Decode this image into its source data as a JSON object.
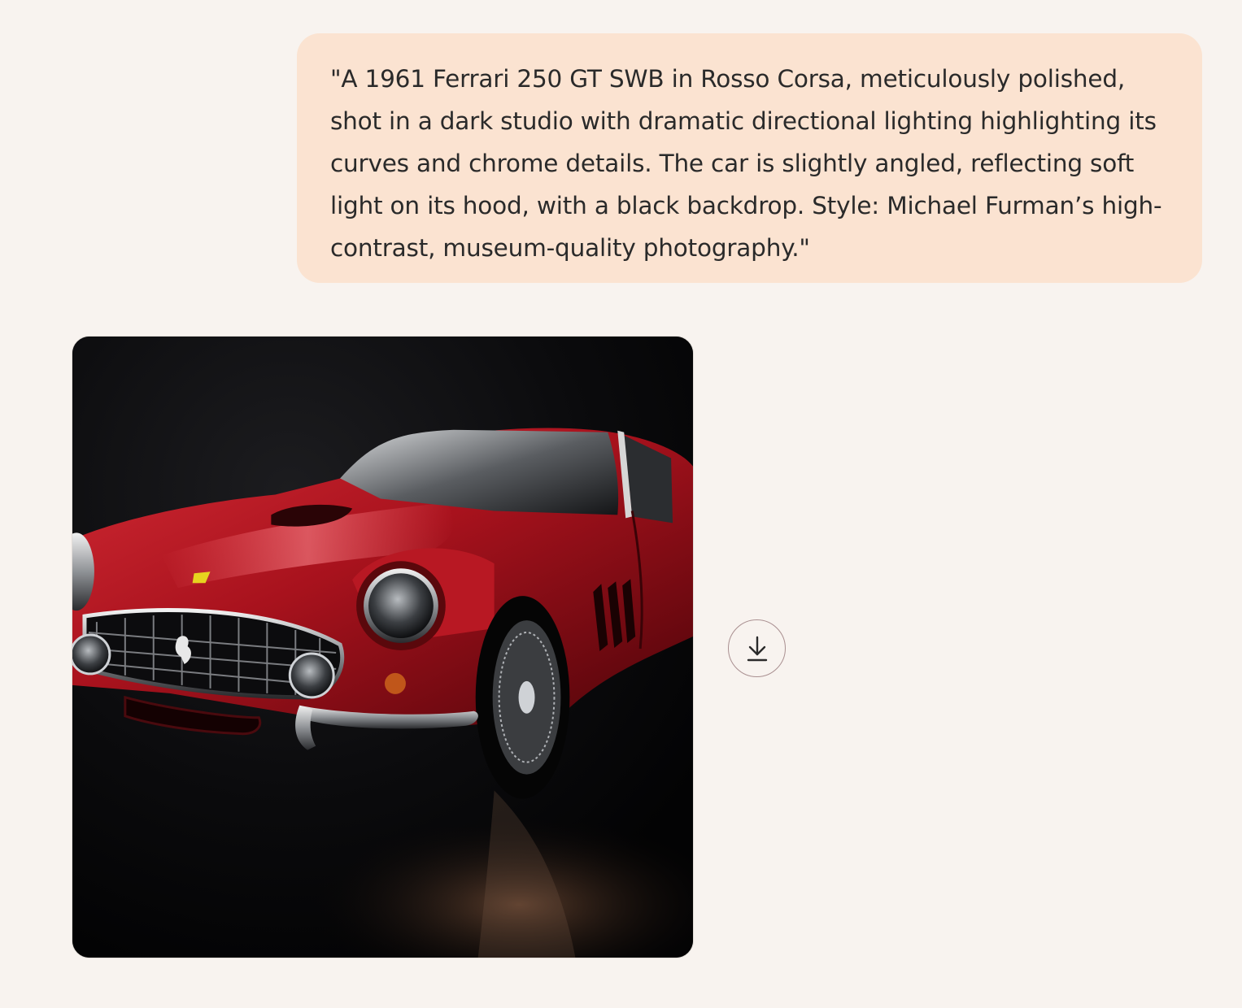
{
  "conversation": {
    "user_message": {
      "text": "\"A 1961 Ferrari 250 GT SWB in Rosso Corsa, meticulously polished, shot in a dark studio with dramatic directional lighting highlighting its curves and chrome details. The car is slightly angled, reflecting soft light on its hood, with a black backdrop. Style: Michael Furman’s high-contrast, museum-quality photography.\""
    },
    "assistant_response": {
      "image_icon": "generated-image",
      "download_icon": "download-icon"
    }
  },
  "colors": {
    "page_background": "#f8f3ef",
    "user_bubble": "#fbe3d1",
    "text": "#2a2a2a",
    "download_ring": "#a98f90",
    "car_red": "#a3121c"
  }
}
